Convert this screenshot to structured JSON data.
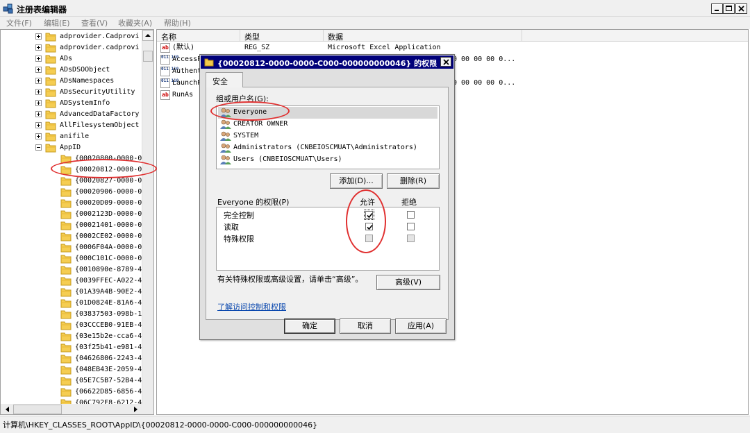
{
  "window": {
    "title": "注册表编辑器"
  },
  "menu": [
    "文件(F)",
    "编辑(E)",
    "查看(V)",
    "收藏夹(A)",
    "帮助(H)"
  ],
  "tree": {
    "items": [
      {
        "label": "adprovider.Cadprovi",
        "expander": "plus"
      },
      {
        "label": "adprovider.cadprovi",
        "expander": "plus"
      },
      {
        "label": "ADs",
        "expander": "plus"
      },
      {
        "label": "ADsDSOObject",
        "expander": "plus"
      },
      {
        "label": "ADsNamespaces",
        "expander": "plus"
      },
      {
        "label": "ADsSecurityUtility",
        "expander": "plus"
      },
      {
        "label": "ADSystemInfo",
        "expander": "plus"
      },
      {
        "label": "AdvancedDataFactory",
        "expander": "plus"
      },
      {
        "label": "AllFilesystemObject",
        "expander": "plus"
      },
      {
        "label": "anifile",
        "expander": "plus"
      },
      {
        "label": "AppID",
        "expander": "minus"
      },
      {
        "label": "{00020800-0000-0"
      },
      {
        "label": "{00020812-0000-0"
      },
      {
        "label": "{00020827-0000-0"
      },
      {
        "label": "{00020906-0000-0"
      },
      {
        "label": "{00020D09-0000-0"
      },
      {
        "label": "{0002123D-0000-0"
      },
      {
        "label": "{00021401-0000-0"
      },
      {
        "label": "{0002CE02-0000-0"
      },
      {
        "label": "{0006F04A-0000-0"
      },
      {
        "label": "{000C101C-0000-0"
      },
      {
        "label": "{0010890e-8789-4"
      },
      {
        "label": "{0039FFEC-A022-4"
      },
      {
        "label": "{01A39A4B-90E2-4"
      },
      {
        "label": "{01D0824E-81A6-4"
      },
      {
        "label": "{03837503-098b-1"
      },
      {
        "label": "{03CCCEB0-91EB-4"
      },
      {
        "label": "{03e15b2e-cca6-4"
      },
      {
        "label": "{03f25b41-e981-4"
      },
      {
        "label": "{04626806-2243-4"
      },
      {
        "label": "{048EB43E-2059-4"
      },
      {
        "label": "{05E7C5B7-52B4-4"
      },
      {
        "label": "{06622D85-6856-4"
      },
      {
        "label": "{06C792F8-6212-4"
      }
    ]
  },
  "list": {
    "columns": [
      "名称",
      "类型",
      "数据"
    ],
    "rows": [
      {
        "icon": "string-value-icon",
        "name": "(默认)",
        "type": "REG_SZ",
        "data": "Microsoft Excel Application"
      },
      {
        "icon": "binary-value-icon",
        "name": "AccessP",
        "type": "",
        "data": "0 00 00 00 0..."
      },
      {
        "icon": "binary-value-icon",
        "name": "Authent",
        "type": "",
        "data": ""
      },
      {
        "icon": "binary-value-icon",
        "name": "LaunchP",
        "type": "",
        "data": "0 00 00 00 0..."
      },
      {
        "icon": "string-value-icon",
        "name": "RunAs",
        "type": "",
        "data": ""
      }
    ]
  },
  "status": "计算机\\HKEY_CLASSES_ROOT\\AppID\\{00020812-0000-0000-C000-000000000046}",
  "dialog": {
    "title": "{00020812-0000-0000-C000-000000000046} 的权限",
    "tab": "安全",
    "group_label": "组或用户名(G):",
    "users": [
      {
        "name": "Everyone"
      },
      {
        "name": "CREATOR OWNER"
      },
      {
        "name": "SYSTEM"
      },
      {
        "name": "Administrators (CNBEIOSCMUAT\\Administrators)"
      },
      {
        "name": "Users (CNBEIOSCMUAT\\Users)"
      }
    ],
    "add_button": "添加(D)...",
    "remove_button": "删除(R)",
    "perm_label": "Everyone 的权限(P)",
    "allow_header": "允许",
    "deny_header": "拒绝",
    "permissions": [
      {
        "name": "完全控制",
        "allow": true,
        "deny": false
      },
      {
        "name": "读取",
        "allow": true,
        "deny": false
      },
      {
        "name": "特殊权限",
        "allow": false,
        "deny": false
      }
    ],
    "advanced_text": "有关特殊权限或高级设置，请单击“高级”。",
    "advanced_button": "高级(V)",
    "learn_link": "了解访问控制和权限",
    "ok_button": "确定",
    "cancel_button": "取消",
    "apply_button": "应用(A)"
  }
}
